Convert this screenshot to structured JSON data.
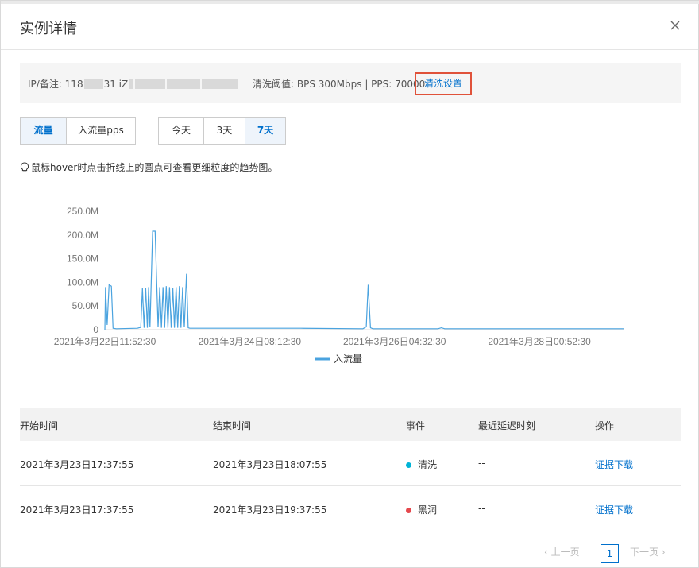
{
  "dialog": {
    "title": "实例详情"
  },
  "info": {
    "ip_label": "IP/备注: 118",
    "ip_mid": "31 iZ",
    "threshold": "清洗阈值: BPS 300Mbps | PPS: 70000",
    "clean_settings": "清洗设置"
  },
  "metric_tabs": [
    {
      "label": "流量",
      "active": true
    },
    {
      "label": "入流量pps",
      "active": false
    }
  ],
  "range_tabs": [
    {
      "label": "今天",
      "active": false
    },
    {
      "label": "3天",
      "active": false
    },
    {
      "label": "7天",
      "active": true
    }
  ],
  "hint": "鼠标hover时点击折线上的圆点可查看更细粒度的趋势图。",
  "chart_data": {
    "type": "line",
    "title": "",
    "xlabel": "",
    "ylabel": "",
    "ylim": [
      0,
      250
    ],
    "y_unit": "M",
    "yticks": [
      "0",
      "50.0M",
      "100.0M",
      "150.0M",
      "200.0M",
      "250.0M"
    ],
    "xticks": [
      "2021年3月22日11:52:30",
      "2021年3月24日08:12:30",
      "2021年3月26日04:32:30",
      "2021年3月28日00:52:30"
    ],
    "x_hours_range": [
      0,
      159
    ],
    "legend_position": "bottom",
    "color": "#4aa3df",
    "series": [
      {
        "name": "入流量",
        "points": [
          [
            0.0,
            0
          ],
          [
            0.2,
            90
          ],
          [
            0.7,
            10
          ],
          [
            1.3,
            95
          ],
          [
            2.0,
            92
          ],
          [
            2.5,
            3
          ],
          [
            3.5,
            2
          ],
          [
            10.0,
            3
          ],
          [
            11.0,
            5
          ],
          [
            11.5,
            88
          ],
          [
            12.0,
            4
          ],
          [
            12.5,
            88
          ],
          [
            13.0,
            4
          ],
          [
            13.4,
            90
          ],
          [
            13.8,
            5
          ],
          [
            14.6,
            208
          ],
          [
            15.4,
            208
          ],
          [
            16.3,
            5
          ],
          [
            16.8,
            90
          ],
          [
            17.3,
            4
          ],
          [
            17.8,
            90
          ],
          [
            18.3,
            4
          ],
          [
            18.8,
            92
          ],
          [
            19.3,
            4
          ],
          [
            19.8,
            90
          ],
          [
            20.3,
            4
          ],
          [
            20.8,
            88
          ],
          [
            21.3,
            4
          ],
          [
            21.8,
            90
          ],
          [
            22.3,
            4
          ],
          [
            22.8,
            92
          ],
          [
            23.3,
            4
          ],
          [
            23.8,
            90
          ],
          [
            24.3,
            5
          ],
          [
            25.0,
            118
          ],
          [
            25.5,
            4
          ],
          [
            26.0,
            3
          ],
          [
            60.0,
            3
          ],
          [
            79.0,
            2
          ],
          [
            80.0,
            6
          ],
          [
            80.6,
            95
          ],
          [
            81.3,
            4
          ],
          [
            82.0,
            2
          ],
          [
            102.0,
            2
          ],
          [
            103.0,
            4
          ],
          [
            104.0,
            2
          ],
          [
            159.0,
            2
          ]
        ]
      }
    ]
  },
  "table": {
    "columns": [
      "开始时间",
      "结束时间",
      "事件",
      "最近延迟时刻",
      "操作"
    ],
    "rows": [
      {
        "start": "2021年3月23日17:37:55",
        "end": "2021年3月23日18:07:55",
        "event": "清洗",
        "event_color": "#00b3d6",
        "delay": "--",
        "action": "证据下载"
      },
      {
        "start": "2021年3月23日17:37:55",
        "end": "2021年3月23日19:37:55",
        "event": "黑洞",
        "event_color": "#e5484d",
        "delay": "--",
        "action": "证据下载"
      }
    ]
  },
  "pagination": {
    "prev": "上一页",
    "current": "1",
    "next": "下一页"
  }
}
